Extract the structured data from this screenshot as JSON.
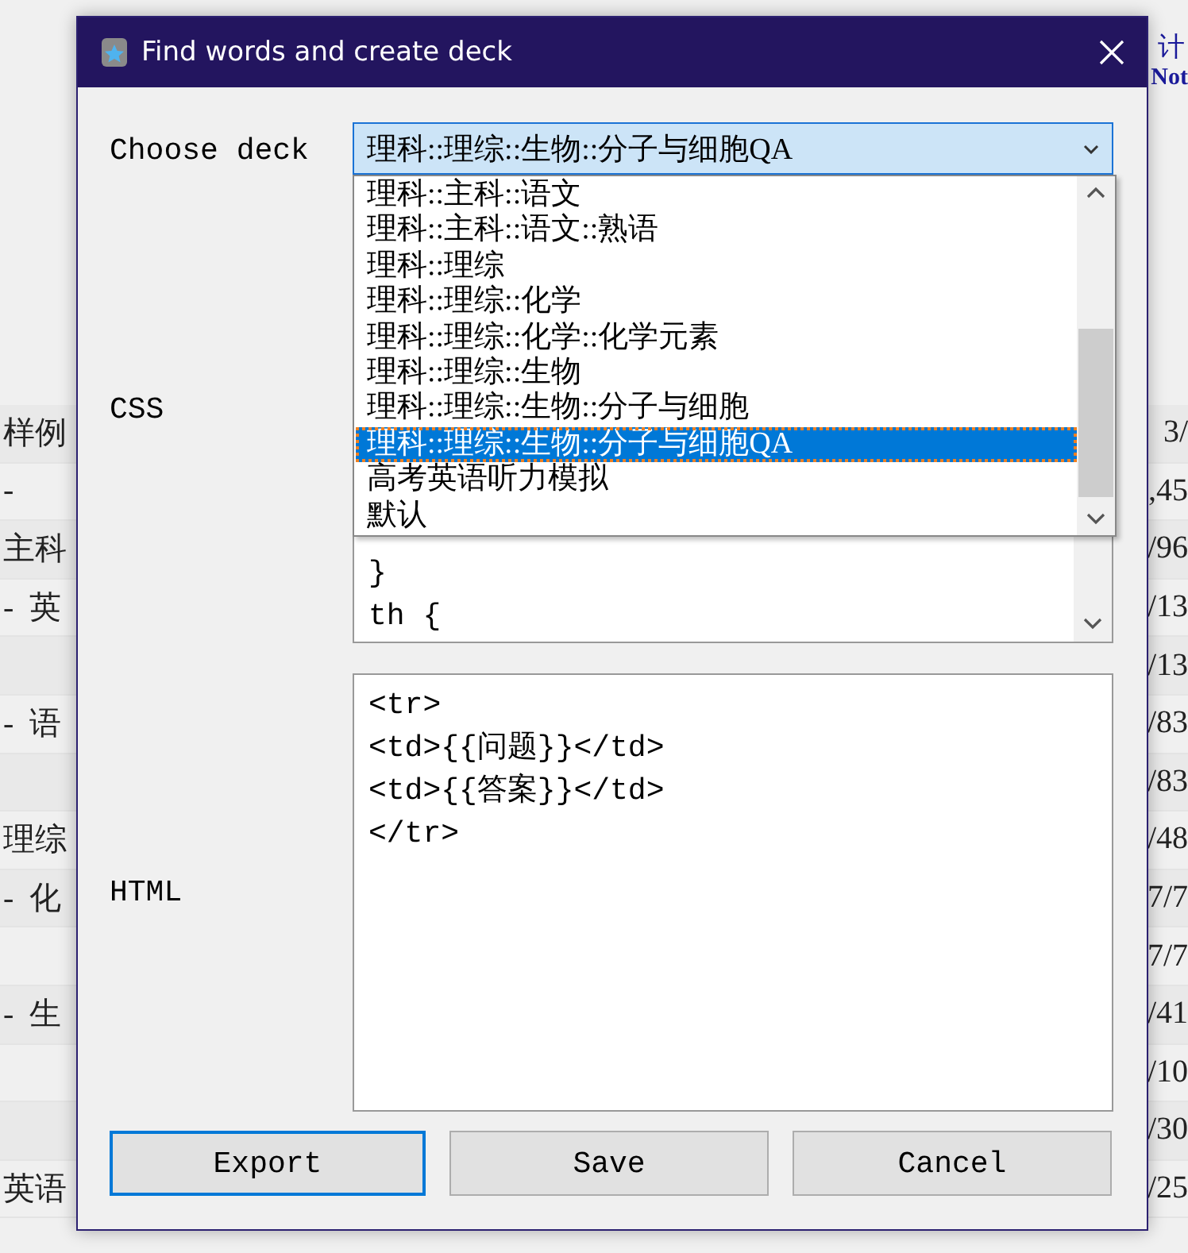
{
  "background": {
    "header": [
      "计",
      "Not"
    ],
    "rows": [
      {
        "left": "样例",
        "right": "3/"
      },
      {
        "left": "-",
        "right": ",45"
      },
      {
        "left": "主科",
        "right": "/96"
      },
      {
        "left": "-  英",
        "right": "/13"
      },
      {
        "left": "",
        "right": "/13"
      },
      {
        "left": "-  语",
        "right": "/83"
      },
      {
        "left": "",
        "right": "/83"
      },
      {
        "left": "理综",
        "right": "/48"
      },
      {
        "left": "-  化",
        "right": "7/7"
      },
      {
        "left": "",
        "right": "7/7"
      },
      {
        "left": "-  生",
        "right": "/41"
      },
      {
        "left": "",
        "right": "/10"
      },
      {
        "left": "",
        "right": "/30"
      },
      {
        "left": "英语",
        "right": "/25"
      }
    ]
  },
  "window": {
    "title": "Find words and create deck"
  },
  "choose_deck": {
    "label": "Choose deck",
    "value": "理科::理综::生物::分子与细胞QA",
    "options": [
      {
        "label": "理科::主科::语文",
        "selected": false
      },
      {
        "label": "理科::主科::语文::熟语",
        "selected": false
      },
      {
        "label": "理科::理综",
        "selected": false
      },
      {
        "label": "理科::理综::化学",
        "selected": false
      },
      {
        "label": "理科::理综::化学::化学元素",
        "selected": false
      },
      {
        "label": "理科::理综::生物",
        "selected": false
      },
      {
        "label": "理科::理综::生物::分子与细胞",
        "selected": false
      },
      {
        "label": "理科::理综::生物::分子与细胞QA",
        "selected": true
      },
      {
        "label": "高考英语听力模拟",
        "selected": false
      },
      {
        "label": "默认",
        "selected": false
      }
    ]
  },
  "css": {
    "label": "CSS",
    "lines": [
      "}",
      "th {"
    ]
  },
  "html": {
    "label": "HTML",
    "lines": [
      "<tr>",
      "<td>{{问题}}</td>",
      "<td>{{答案}}</td>",
      "</tr>"
    ]
  },
  "buttons": [
    {
      "label": "Export",
      "focused": true
    },
    {
      "label": "Save",
      "focused": false
    },
    {
      "label": "Cancel",
      "focused": false
    }
  ]
}
